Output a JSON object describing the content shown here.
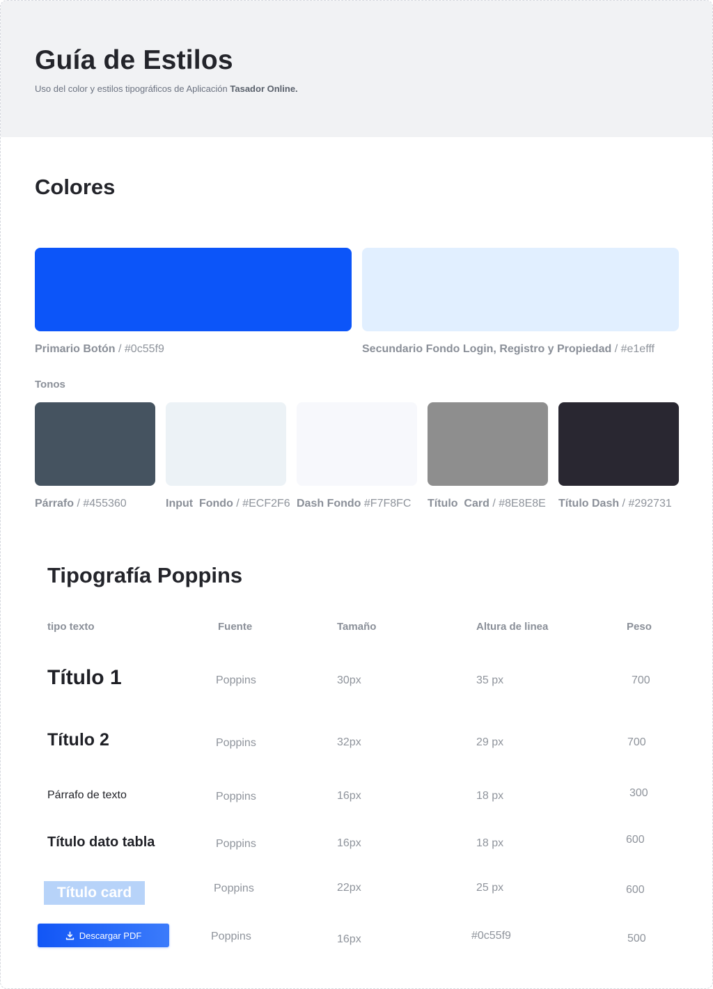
{
  "header": {
    "title": "Guía de Estilos",
    "subtitle_prefix": "Uso del color y estilos tipográficos de Aplicación",
    "subtitle_app": "Tasador Online."
  },
  "colores": {
    "title": "Colores",
    "primary": {
      "name": "Primario Botón",
      "hex": "#0c55f9",
      "color": "#0c55f9"
    },
    "secondary": {
      "name": "Secundario Fondo Login, Registro y Propiedad",
      "hex": "#e1efff",
      "color": "#e1efff"
    },
    "tonos_label": "Tonos",
    "tonos": [
      {
        "name": "Párrafo",
        "hex": "#455360",
        "color": "#455360"
      },
      {
        "name": "Input  Fondo",
        "hex": "#ECF2F6",
        "color": "#ECF2F6"
      },
      {
        "name": "Dash Fondo",
        "hex": "#F7F8FC",
        "color": "#F7F8FC"
      },
      {
        "name": "Título  Card",
        "hex": "#8E8E8E",
        "color": "#8E8E8E"
      },
      {
        "name": "Título Dash",
        "hex": "#292731",
        "color": "#292731"
      }
    ]
  },
  "tipografia": {
    "title": "Tipografía Poppins",
    "headers": {
      "tipo": "tipo texto",
      "fuente": "Fuente",
      "tamano": "Tamaño",
      "altura": "Altura de linea",
      "peso": "Peso"
    },
    "rows": [
      {
        "sample": "Título 1",
        "fuente": "Poppins",
        "tamano": "30px",
        "altura": "35 px",
        "peso": "700"
      },
      {
        "sample": "Título 2",
        "fuente": "Poppins",
        "tamano": "32px",
        "altura": "29 px",
        "peso": "700"
      },
      {
        "sample": "Párrafo de texto",
        "fuente": "Poppins",
        "tamano": "16px",
        "altura": "18 px",
        "peso": "300"
      },
      {
        "sample": "Título dato tabla",
        "fuente": "Poppins",
        "tamano": "16px",
        "altura": "18 px",
        "peso": "600"
      },
      {
        "sample": "Título card",
        "fuente": "Poppins",
        "tamano": "22px",
        "altura": "25 px",
        "peso": "600"
      },
      {
        "sample": "Descargar PDF",
        "fuente": "Poppins",
        "tamano": "16px",
        "altura": "#0c55f9",
        "peso": "500"
      }
    ]
  },
  "icons": {
    "download": "download-icon"
  }
}
